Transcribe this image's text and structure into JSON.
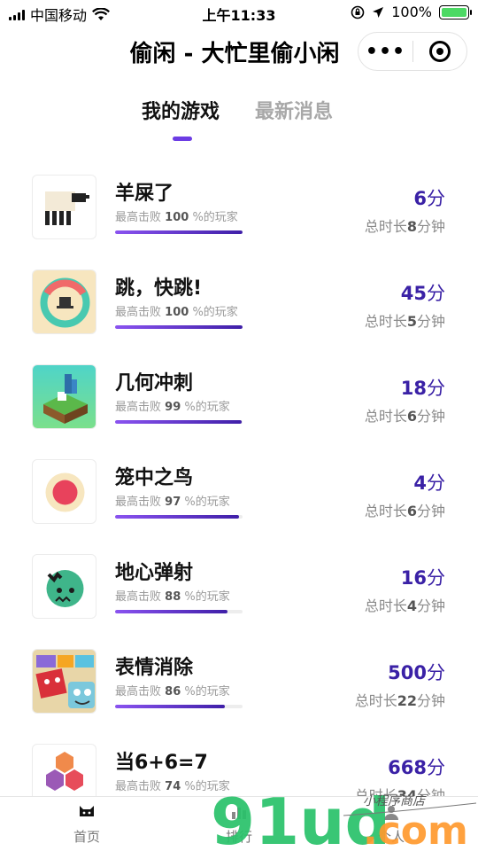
{
  "status": {
    "carrier": "中国移动",
    "time": "上午11:33",
    "battery": "100%"
  },
  "nav": {
    "title": "偷闲 - 大忙里偷小闲",
    "more_icon": "more-dots-icon",
    "close_icon": "target-close-icon"
  },
  "tabs": {
    "active": "我的游戏",
    "inactive": "最新消息"
  },
  "rank_prefix": "最高击败",
  "rank_suffix": "%的玩家",
  "score_unit": "分",
  "time_prefix": "总时长",
  "time_unit": "分钟",
  "games": [
    {
      "name": "羊屎了",
      "rank": "100",
      "progress": 100,
      "score": "6",
      "time": "8",
      "icon": "sheep-icon"
    },
    {
      "name": "跳，快跳!",
      "rank": "100",
      "progress": 100,
      "score": "45",
      "time": "5",
      "icon": "ring-jump-icon"
    },
    {
      "name": "几何冲刺",
      "rank": "99",
      "progress": 99,
      "score": "18",
      "time": "6",
      "icon": "geometry-dash-icon"
    },
    {
      "name": "笼中之鸟",
      "rank": "97",
      "progress": 97,
      "score": "4",
      "time": "6",
      "icon": "red-dot-icon"
    },
    {
      "name": "地心弹射",
      "rank": "88",
      "progress": 88,
      "score": "16",
      "time": "4",
      "icon": "green-ball-icon"
    },
    {
      "name": "表情消除",
      "rank": "86",
      "progress": 86,
      "score": "500",
      "time": "22",
      "icon": "emoji-faces-icon"
    },
    {
      "name": "当6+6=7",
      "rank": "74",
      "progress": 74,
      "score": "668",
      "time": "34",
      "icon": "hexagons-icon"
    }
  ],
  "tabbar": {
    "home": "首页",
    "rank": "排行",
    "me": "个人"
  },
  "watermark": {
    "text": "91ud.com",
    "sub": "小程序商店"
  },
  "colors": {
    "accent": "#3a21a6",
    "progress_start": "#8a53f0",
    "progress_end": "#3f1fa8",
    "tab_indicator": "#6c3ce4"
  }
}
